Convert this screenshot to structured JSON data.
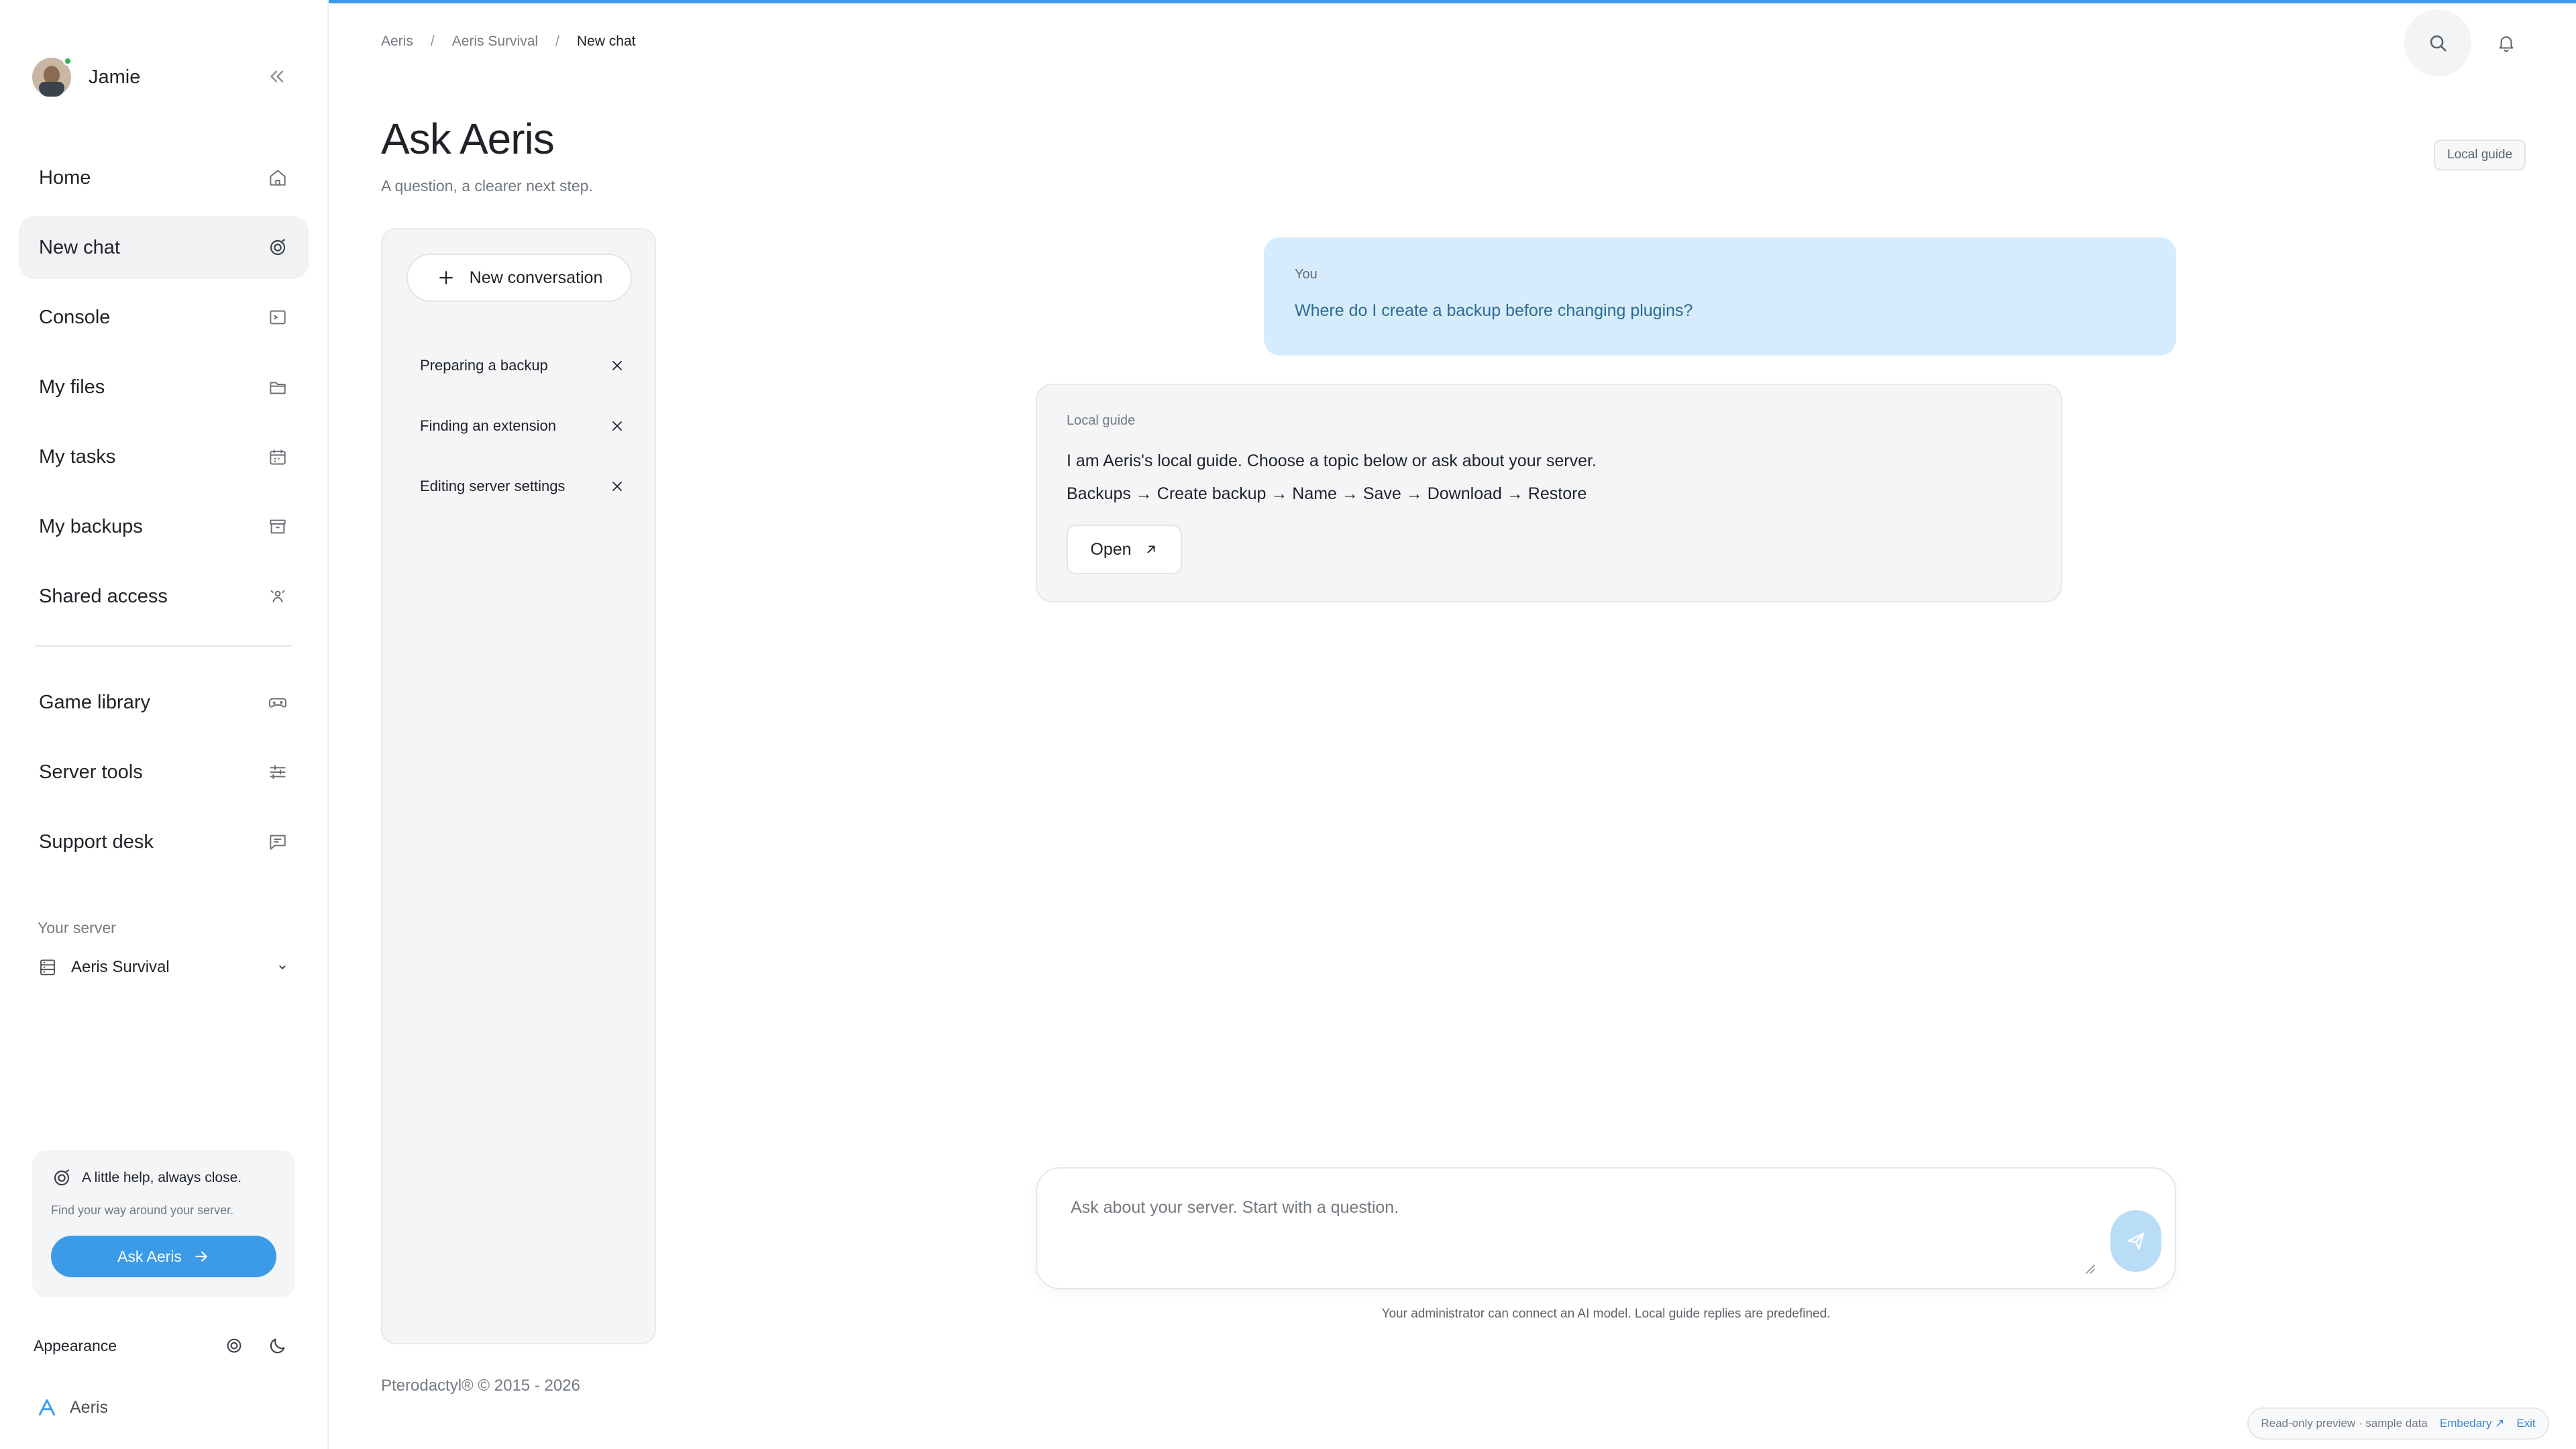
{
  "user": {
    "name": "Jamie"
  },
  "nav": {
    "items": [
      {
        "label": "Home",
        "icon": "home-icon"
      },
      {
        "label": "New chat",
        "icon": "chat-swirl-icon",
        "active": true
      },
      {
        "label": "Console",
        "icon": "terminal-icon"
      },
      {
        "label": "My files",
        "icon": "folder-icon"
      },
      {
        "label": "My tasks",
        "icon": "calendar-icon"
      },
      {
        "label": "My backups",
        "icon": "archive-icon"
      },
      {
        "label": "Shared access",
        "icon": "people-icon"
      }
    ],
    "secondary": [
      {
        "label": "Game library",
        "icon": "gamepad-icon"
      },
      {
        "label": "Server tools",
        "icon": "sliders-icon"
      },
      {
        "label": "Support desk",
        "icon": "message-icon"
      }
    ]
  },
  "server": {
    "label": "Your server",
    "selected": "Aeris Survival"
  },
  "help_card": {
    "title": "A little help, always close.",
    "subtitle": "Find your way around your server.",
    "button": "Ask Aeris"
  },
  "appearance": {
    "label": "Appearance"
  },
  "brand": {
    "name": "Aeris"
  },
  "breadcrumb": {
    "root": "Aeris",
    "server": "Aeris Survival",
    "current": "New chat"
  },
  "page": {
    "title": "Ask Aeris",
    "subtitle": "A question, a clearer next step.",
    "badge": "Local guide"
  },
  "conversations": {
    "new_label": "New conversation",
    "items": [
      "Preparing a backup",
      "Finding an extension",
      "Editing server settings"
    ]
  },
  "chat": {
    "user_msg": {
      "who": "You",
      "text": "Where do I create a backup before changing plugins?"
    },
    "guide_msg": {
      "who": "Local guide",
      "line1": "I am Aeris's local guide. Choose a topic below or ask about your server.",
      "line2": "Backups → Create backup → Name → Save → Download → Restore",
      "button": "Open"
    }
  },
  "composer": {
    "placeholder": "Ask about your server. Start with a question.",
    "value": "",
    "disclaimer": "Your administrator can connect an AI model. Local guide replies are predefined."
  },
  "footer": {
    "copyright": "Pterodactyl® © 2015 - 2026"
  },
  "preview": {
    "text": "Read-only preview · sample data",
    "link": "Embedary ↗",
    "exit": "Exit"
  },
  "colors": {
    "accent": "#3b9be8",
    "user_bubble": "#d6ebfb",
    "panel": "#f4f5f7"
  }
}
